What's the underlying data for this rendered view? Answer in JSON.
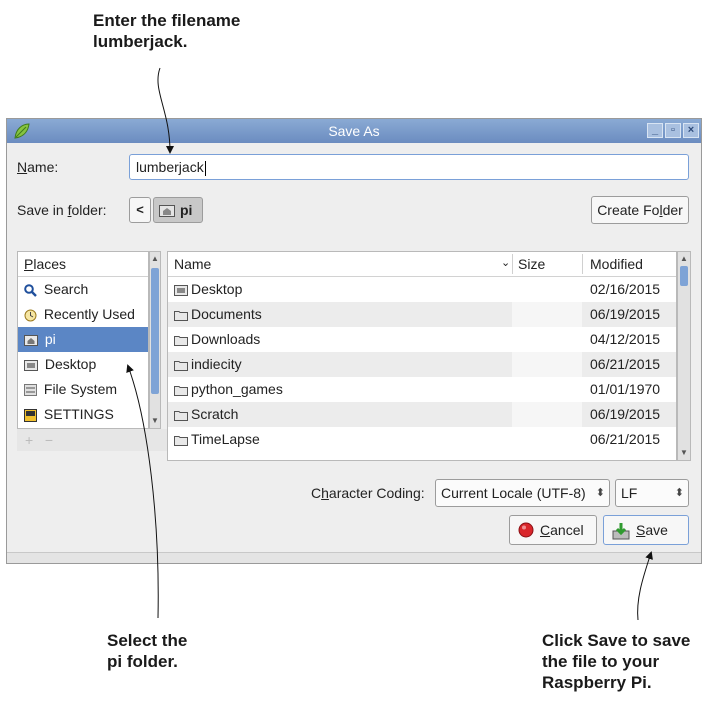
{
  "annotations": {
    "top": "Enter the filename\nlumberjack.",
    "left": "Select the\npi folder.",
    "right": "Click Save to save\nthe file to your\nRaspberry Pi."
  },
  "window": {
    "title": "Save As",
    "buttons": [
      "minimize-icon",
      "maximize-icon",
      "close-icon"
    ]
  },
  "name_field": {
    "label_key": "N",
    "label_rest": "ame:",
    "value": "lumberjack"
  },
  "folder": {
    "label_pre": "Save in ",
    "label_key": "f",
    "label_rest": "older:",
    "back": "<",
    "current": "pi",
    "create_pre": "Create Fo",
    "create_key": "l",
    "create_rest": "der"
  },
  "places": {
    "header_key": "P",
    "header_rest": "laces",
    "items": [
      {
        "label": "Search",
        "icon": "search-icon"
      },
      {
        "label": "Recently Used",
        "icon": "clock-icon"
      },
      {
        "label": "pi",
        "icon": "home-folder-icon",
        "selected": true
      },
      {
        "label": "Desktop",
        "icon": "desktop-folder-icon"
      },
      {
        "label": "File System",
        "icon": "drive-icon"
      },
      {
        "label": "SETTINGS",
        "icon": "usb-drive-icon"
      }
    ],
    "add": "+",
    "remove": "−"
  },
  "files": {
    "columns": {
      "name": "Name",
      "size": "Size",
      "modified": "Modified"
    },
    "rows": [
      {
        "name": "Desktop",
        "modified": "02/16/2015",
        "icon": "desktop-folder-icon"
      },
      {
        "name": "Documents",
        "modified": "06/19/2015",
        "icon": "folder-icon"
      },
      {
        "name": "Downloads",
        "modified": "04/12/2015",
        "icon": "folder-icon"
      },
      {
        "name": "indiecity",
        "modified": "06/21/2015",
        "icon": "folder-icon"
      },
      {
        "name": "python_games",
        "modified": "01/01/1970",
        "icon": "folder-icon"
      },
      {
        "name": "Scratch",
        "modified": "06/19/2015",
        "icon": "folder-icon"
      },
      {
        "name": "TimeLapse",
        "modified": "06/21/2015",
        "icon": "folder-icon"
      }
    ]
  },
  "coding": {
    "label_pre": "C",
    "label_key": "h",
    "label_rest": "aracter Coding:",
    "value": "Current Locale (UTF-8)",
    "line_ending": "LF"
  },
  "actions": {
    "cancel_key": "C",
    "cancel_rest": "ancel",
    "save_key": "S",
    "save_rest": "ave"
  },
  "colors": {
    "title_bar": "#7a9bcc",
    "selection": "#5b86c5",
    "focus_border": "#7aa0d8"
  }
}
